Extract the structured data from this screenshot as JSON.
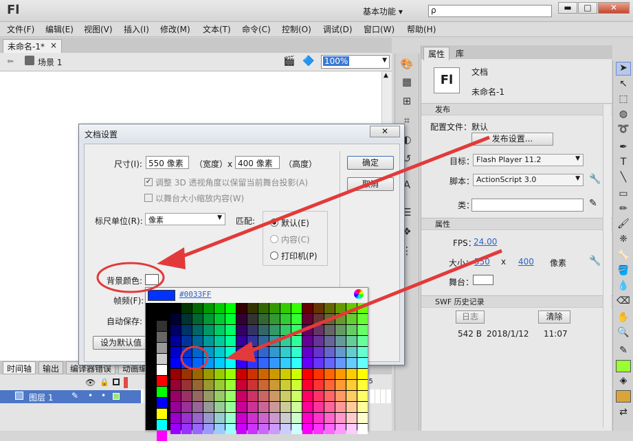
{
  "app": {
    "logo": "Fl",
    "workspace": "基本功能 ▾",
    "search_placeholder": "ρ"
  },
  "window_controls": {
    "minimize": "▬",
    "maximize": "□",
    "close": "✕"
  },
  "menu": [
    "文件(F)",
    "编辑(E)",
    "视图(V)",
    "插入(I)",
    "修改(M)",
    "文本(T)",
    "命令(C)",
    "控制(O)",
    "调试(D)",
    "窗口(W)",
    "帮助(H)"
  ],
  "doc_tab": {
    "label": "未命名-1*",
    "close": "×"
  },
  "scene": {
    "label": "场景 1",
    "zoom": "100%"
  },
  "timeline_tabs": [
    "时间轴",
    "输出",
    "编译器错误",
    "动画编"
  ],
  "timeline": {
    "layer": "图层 1",
    "frame_marker": "45"
  },
  "properties": {
    "tabs": [
      "属性",
      "库"
    ],
    "doc_type": "文档",
    "doc_name": "未命名-1",
    "doc_icon": "Fl",
    "publish": {
      "header": "发布",
      "profile_label": "配置文件：默认",
      "settings_button": "发布设置...",
      "target_label": "目标：",
      "target_value": "Flash Player 11.2",
      "script_label": "脚本：",
      "script_value": "ActionScript 3.0",
      "class_label": "类："
    },
    "props": {
      "header": "属性",
      "fps_label": "FPS：",
      "fps_value": "24.00",
      "size_label": "大小：",
      "width": "550",
      "x": "x",
      "height": "400",
      "unit": "像素",
      "stage_label": "舞台："
    },
    "swf": {
      "header": "SWF 历史记录",
      "log_button": "日志",
      "clear_button": "清除",
      "size": "542 B",
      "date": "2018/1/12",
      "time": "11:07"
    }
  },
  "dialog": {
    "title": "文档设置",
    "close": "✕",
    "size_label": "尺寸(I):",
    "width_value": "550 像素",
    "width_label": "（宽度）x",
    "height_value": "400 像素",
    "height_label": "（高度）",
    "adjust3d": "调整 3D 透视角度以保留当前舞台投影(A)",
    "scale_content": "以舞台大小缩放内容(W)",
    "ruler_label": "标尺单位(R):",
    "ruler_value": "像素",
    "match_label": "匹配:",
    "match_default": "默认(E)",
    "match_content": "内容(C)",
    "match_printer": "打印机(P)",
    "bg_label": "背景颜色:",
    "fps_label": "帧频(F):",
    "autosave_label": "自动保存:",
    "set_default": "设为默认值",
    "ok": "确定",
    "cancel": "取消"
  },
  "color_picker": {
    "selected_hex": "#0033FF",
    "selected_color": "#0033FF"
  },
  "colors": {
    "accent_annotation": "#e23a3a",
    "layer_highlight": "#4d76c6",
    "link": "#2a62c4",
    "fill_green": "#99ff33"
  }
}
